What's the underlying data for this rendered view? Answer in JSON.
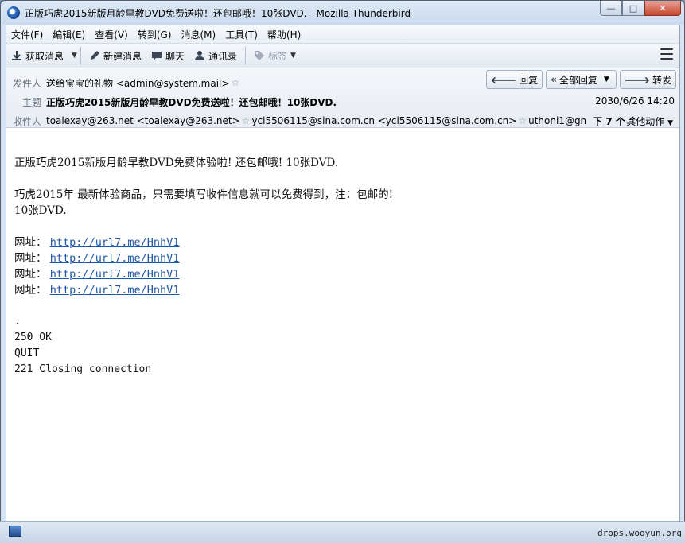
{
  "window": {
    "title": "正版巧虎2015新版月龄早教DVD免费送啦！还包邮哦！10张DVD. - Mozilla Thunderbird",
    "buttons": {
      "minimize": "—",
      "maximize": "□",
      "close": "✕"
    }
  },
  "menubar": {
    "items": [
      "文件(F)",
      "编辑(E)",
      "查看(V)",
      "转到(G)",
      "消息(M)",
      "工具(T)",
      "帮助(H)"
    ]
  },
  "toolbar": {
    "get_messages": "获取消息",
    "write": "新建消息",
    "chat": "聊天",
    "address_book": "通讯录",
    "tag": "标签"
  },
  "header": {
    "from_label": "发件人",
    "from_value": "送给宝宝的礼物 <admin@system.mail>",
    "subject_label": "主题",
    "subject_value": "正版巧虎2015新版月龄早教DVD免费送啦！还包邮哦！10张DVD.",
    "date": "2030/6/26 14:20",
    "to_label": "收件人",
    "to_recipients": [
      "toalexay@263.net <toalexay@263.net>",
      "ycl5506115@sina.com.cn <ycl5506115@sina.com.cn>",
      "uthoni1@gn"
    ],
    "more_recipients": "下 7 个",
    "reply": "回复",
    "reply_all": "全部回复",
    "forward": "转发",
    "other_actions": "其他动作"
  },
  "body": {
    "line1": "正版巧虎2015新版月龄早教DVD免费体验啦! 还包邮哦! 10张DVD.",
    "line2": "巧虎2015年 最新体验商品，只需要填写收件信息就可以免费得到，注：包邮的!",
    "line3": "10张DVD.",
    "links": [
      {
        "label": "网址：",
        "url": "http://url7.me/HnhV1"
      },
      {
        "label": "网址：",
        "url": "http://url7.me/HnhV1"
      },
      {
        "label": "网址：",
        "url": "http://url7.me/HnhV1"
      },
      {
        "label": "网址：",
        "url": "http://url7.me/HnhV1"
      }
    ],
    "smtp": [
      ".",
      "250 OK",
      "QUIT",
      "221 Closing connection"
    ]
  },
  "statusbar": {
    "watermark": "drops.wooyun.org"
  }
}
